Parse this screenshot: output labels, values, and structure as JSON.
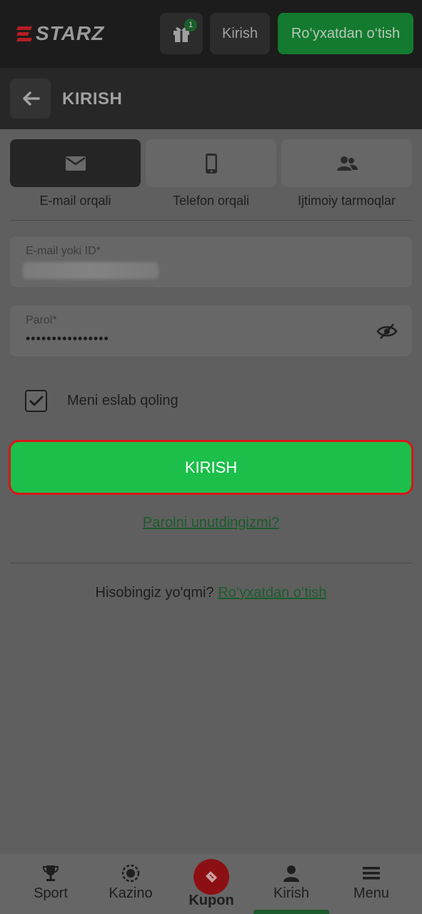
{
  "header": {
    "logo_text": "STARZ",
    "gift_badge_count": "1",
    "login_label": "Kirish",
    "register_label": "Ro‘yxatdan o‘tish"
  },
  "subheader": {
    "title": "KIRISH"
  },
  "tabs": [
    {
      "label": "E-mail orqali",
      "icon": "envelope-icon",
      "active": true
    },
    {
      "label": "Telefon orqali",
      "icon": "phone-icon",
      "active": false
    },
    {
      "label": "Ijtimoiy tarmoqlar",
      "icon": "users-icon",
      "active": false
    }
  ],
  "form": {
    "email_label": "E-mail yoki ID*",
    "password_label": "Parol*",
    "password_value": "••••••••••••••••",
    "remember_label": "Meni eslab qoling",
    "remember_checked": true,
    "submit_label": "KIRISH",
    "forgot_label": "Parolni unutdingizmi?",
    "no_account_text": "Hisobingiz yo'qmi?",
    "register_link": "Ro‘yxatdan o‘tish"
  },
  "bottom_nav": [
    {
      "label": "Sport",
      "icon": "trophy-icon"
    },
    {
      "label": "Kazino",
      "icon": "casino-chip-icon"
    },
    {
      "label": "Kupon",
      "icon": "ticket-icon"
    },
    {
      "label": "Kirish",
      "icon": "user-icon",
      "active": true
    },
    {
      "label": "Menu",
      "icon": "hamburger-icon"
    }
  ],
  "colors": {
    "accent_green": "#1bbf4a",
    "highlight_red": "#d9161b",
    "overlay_gray": "#5f5f5f"
  }
}
